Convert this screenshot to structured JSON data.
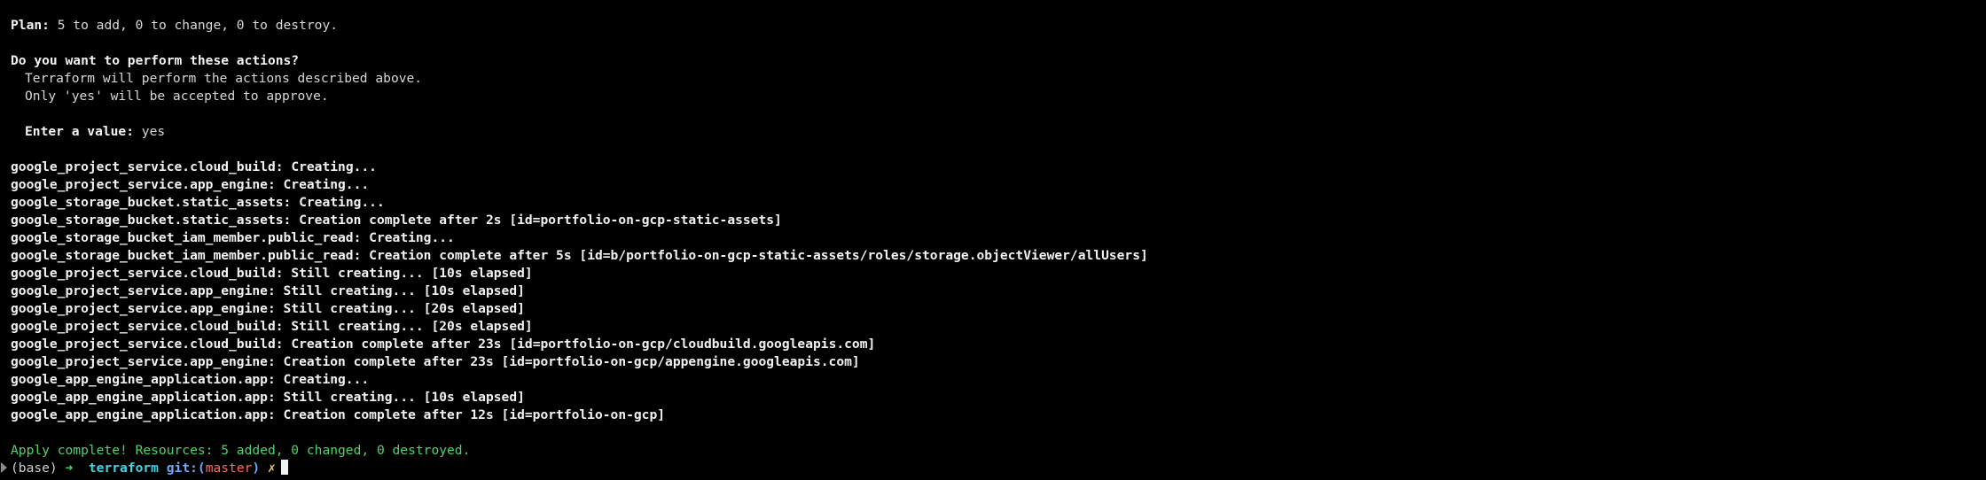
{
  "plan": {
    "label": "Plan:",
    "summary": " 5 to add, 0 to change, 0 to destroy."
  },
  "prompt": {
    "question": "Do you want to perform these actions?",
    "info_1": "Terraform will perform the actions described above.",
    "info_2": "Only 'yes' will be accepted to approve.",
    "enter_label": "Enter a value:",
    "enter_value": " yes"
  },
  "log": [
    {
      "resource": "google_project_service.cloud_build:",
      "message": " Creating..."
    },
    {
      "resource": "google_project_service.app_engine:",
      "message": " Creating..."
    },
    {
      "resource": "google_storage_bucket.static_assets:",
      "message": " Creating..."
    },
    {
      "resource": "google_storage_bucket.static_assets:",
      "message": " Creation complete after 2s [id=portfolio-on-gcp-static-assets]"
    },
    {
      "resource": "google_storage_bucket_iam_member.public_read:",
      "message": " Creating..."
    },
    {
      "resource": "google_storage_bucket_iam_member.public_read:",
      "message": " Creation complete after 5s [id=b/portfolio-on-gcp-static-assets/roles/storage.objectViewer/allUsers]"
    },
    {
      "resource": "google_project_service.cloud_build:",
      "message": " Still creating... [10s elapsed]"
    },
    {
      "resource": "google_project_service.app_engine:",
      "message": " Still creating... [10s elapsed]"
    },
    {
      "resource": "google_project_service.app_engine:",
      "message": " Still creating... [20s elapsed]"
    },
    {
      "resource": "google_project_service.cloud_build:",
      "message": " Still creating... [20s elapsed]"
    },
    {
      "resource": "google_project_service.cloud_build:",
      "message": " Creation complete after 23s [id=portfolio-on-gcp/cloudbuild.googleapis.com]"
    },
    {
      "resource": "google_project_service.app_engine:",
      "message": " Creation complete after 23s [id=portfolio-on-gcp/appengine.googleapis.com]"
    },
    {
      "resource": "google_app_engine_application.app:",
      "message": " Creating..."
    },
    {
      "resource": "google_app_engine_application.app:",
      "message": " Still creating... [10s elapsed]"
    },
    {
      "resource": "google_app_engine_application.app:",
      "message": " Creation complete after 12s [id=portfolio-on-gcp]"
    }
  ],
  "apply_result": "Apply complete! Resources: 5 added, 0 changed, 0 destroyed.",
  "shell_prompt": {
    "env": "(base)",
    "arrow": "➜",
    "directory": "terraform",
    "git_label": "git:(",
    "branch": "master",
    "git_close": ")",
    "dirty_mark": "✗"
  },
  "colors": {
    "background": "#000000",
    "text": "#d7d7d7",
    "success": "#4fd36b",
    "directory": "#3fd6e8",
    "git": "#6ea8ff",
    "branch": "#ff6a5f",
    "dirty": "#f2d14b"
  }
}
